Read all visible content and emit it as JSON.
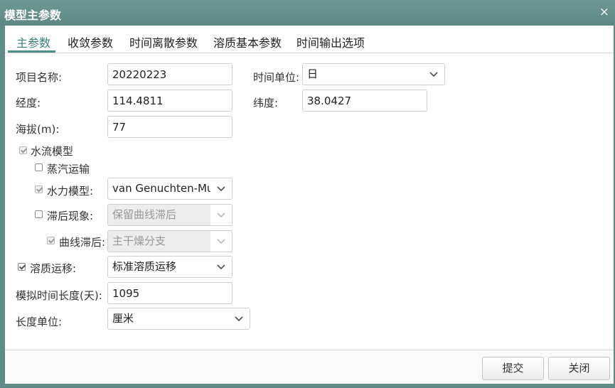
{
  "window": {
    "title": "模型主参数",
    "close_glyph": "×"
  },
  "tabs": [
    {
      "label": "主参数",
      "active": true
    },
    {
      "label": "收敛参数"
    },
    {
      "label": "时间离散参数"
    },
    {
      "label": "溶质基本参数"
    },
    {
      "label": "时间输出选项"
    }
  ],
  "form": {
    "project_name": {
      "label": "项目名称:",
      "value": "20220223"
    },
    "time_unit": {
      "label": "时间单位:",
      "value": "日"
    },
    "longitude": {
      "label": "经度:",
      "value": "114.4811"
    },
    "latitude": {
      "label": "纬度:",
      "value": "38.0427"
    },
    "altitude": {
      "label": "海拔(m):",
      "value": "77"
    },
    "water_flow_model": {
      "label": "水流模型",
      "checked": true
    },
    "vapor_transport": {
      "label": "蒸汽运输",
      "checked": false
    },
    "hydraulic_model": {
      "label": "水力模型:",
      "checked": true,
      "value": "van Genuchten-Mua"
    },
    "hysteresis": {
      "label": "滞后现象:",
      "checked": false,
      "value": "保留曲线滞后"
    },
    "curve_hysteresis": {
      "label": "曲线滞后:",
      "checked": true,
      "value": "主干燥分支"
    },
    "solute_transport": {
      "label": "溶质运移:",
      "checked": true,
      "value": "标准溶质运移"
    },
    "sim_time_length": {
      "label": "模拟时间长度(天):",
      "value": "1095"
    },
    "length_unit": {
      "label": "长度单位:",
      "value": "厘米"
    }
  },
  "buttons": {
    "submit": "提交",
    "close": "关闭"
  },
  "colors": {
    "title_bar": "#5f8a85",
    "accent": "#4d8d86"
  }
}
